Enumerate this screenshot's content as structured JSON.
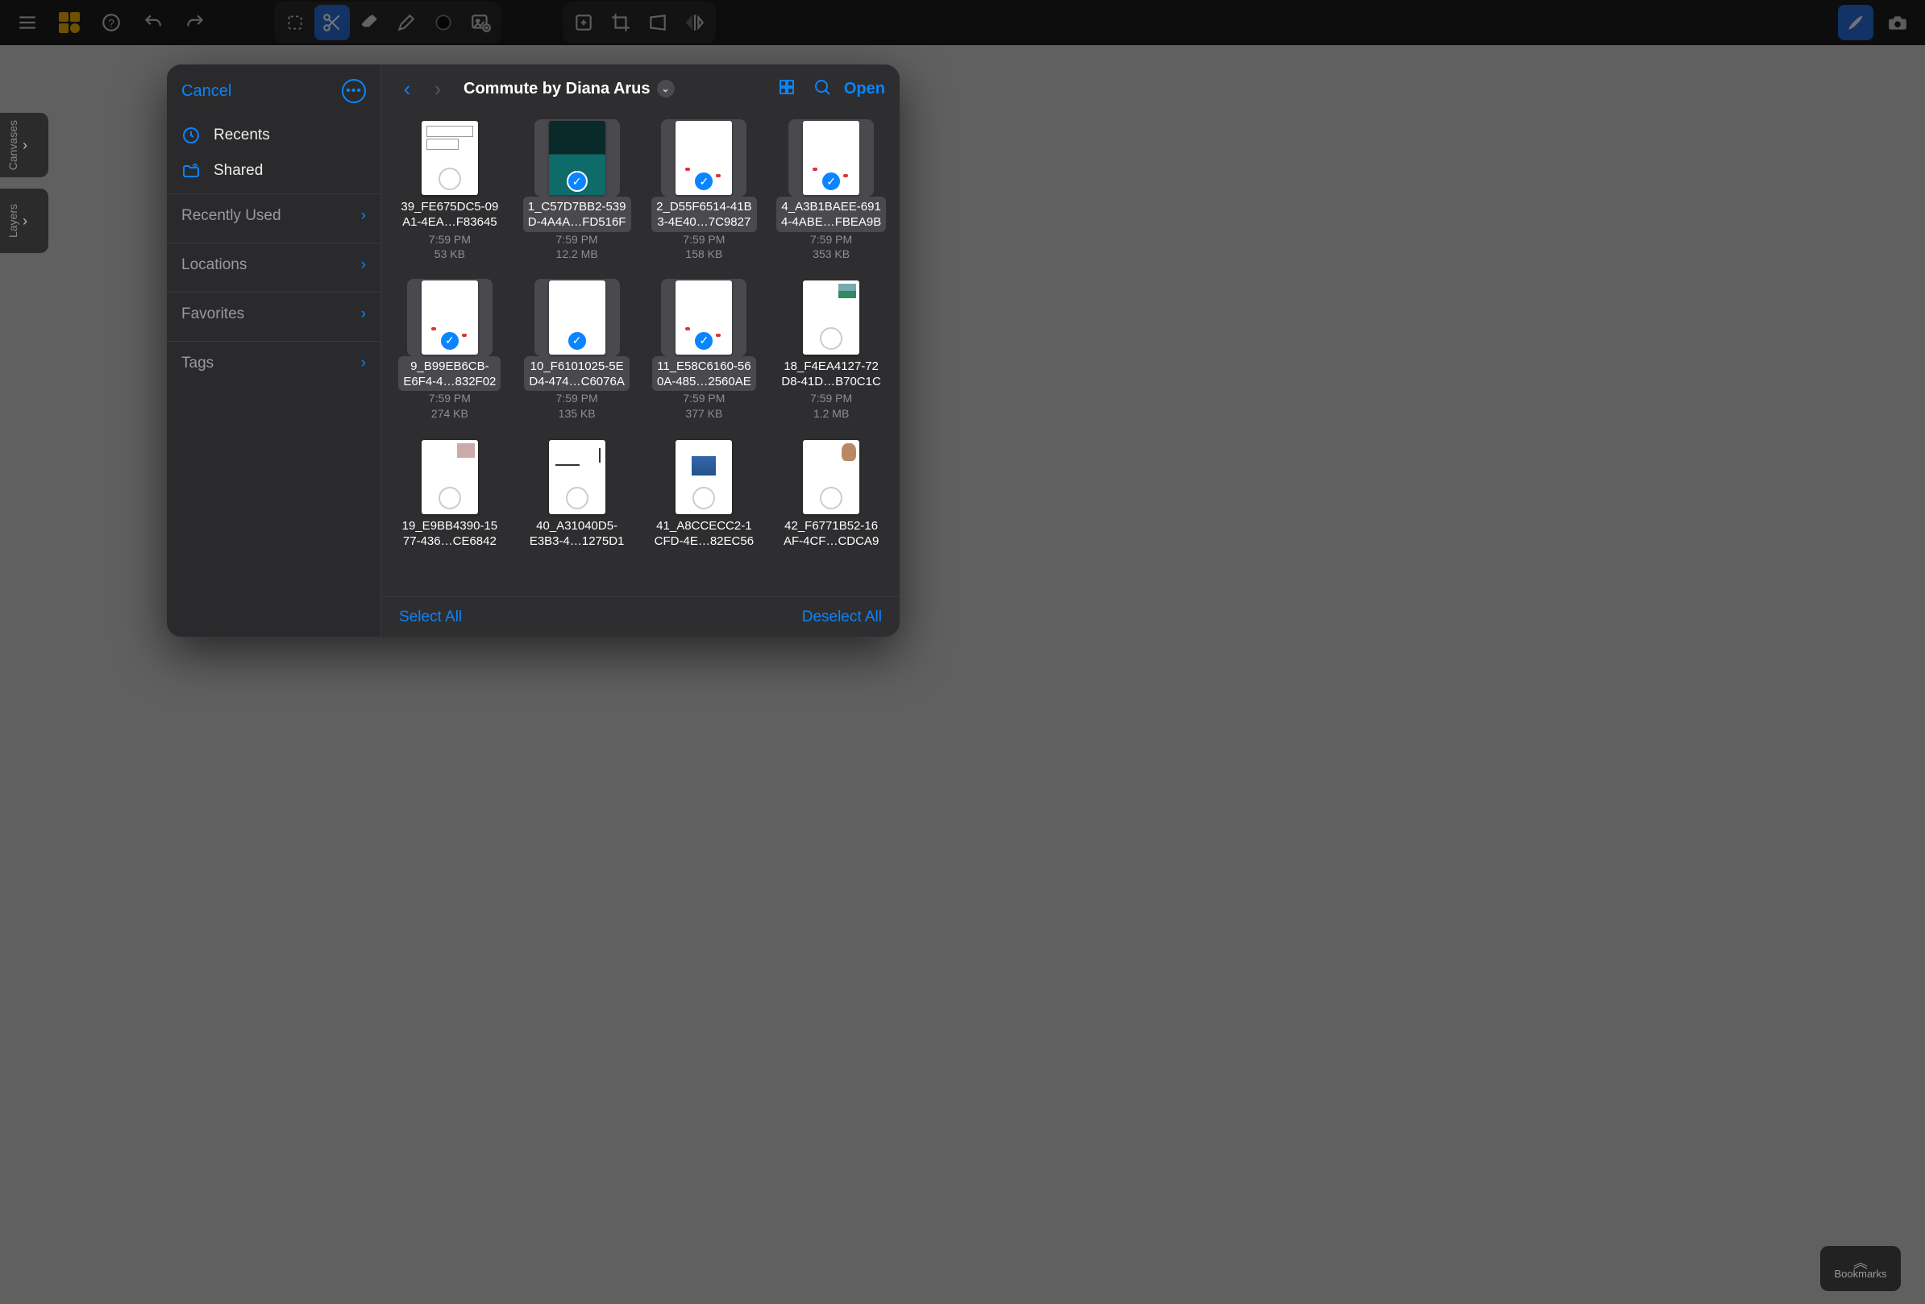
{
  "toolbar": {},
  "side_tabs": {
    "canvases": "Canvases",
    "layers": "Layers"
  },
  "bookmarks_label": "Bookmarks",
  "picker": {
    "cancel": "Cancel",
    "sidebar": {
      "recents": "Recents",
      "shared": "Shared",
      "sections": [
        "Recently Used",
        "Locations",
        "Favorites",
        "Tags"
      ]
    },
    "header": {
      "title": "Commute by Diana Arus",
      "open": "Open"
    },
    "footer": {
      "select_all": "Select All",
      "deselect_all": "Deselect All"
    },
    "files": [
      {
        "name_l1": "39_FE675DC5-09",
        "name_l2": "A1-4EA…F83645",
        "time": "7:59 PM",
        "size": "53 KB",
        "selected": false,
        "thumb": "layout"
      },
      {
        "name_l1": "1_C57D7BB2-539",
        "name_l2": "D-4A4A…FD516F",
        "time": "7:59 PM",
        "size": "12.2 MB",
        "selected": true,
        "thumb": "photo"
      },
      {
        "name_l1": "2_D55F6514-41B",
        "name_l2": "3-4E40…7C9827",
        "time": "7:59 PM",
        "size": "158 KB",
        "selected": true,
        "thumb": "dots"
      },
      {
        "name_l1": "4_A3B1BAEE-691",
        "name_l2": "4-4ABE…FBEA9B",
        "time": "7:59 PM",
        "size": "353 KB",
        "selected": true,
        "thumb": "dots"
      },
      {
        "name_l1": "9_B99EB6CB-",
        "name_l2": "E6F4-4…832F02",
        "time": "7:59 PM",
        "size": "274 KB",
        "selected": true,
        "thumb": "dots"
      },
      {
        "name_l1": "10_F6101025-5E",
        "name_l2": "D4-474…C6076A",
        "time": "7:59 PM",
        "size": "135 KB",
        "selected": true,
        "thumb": "plain"
      },
      {
        "name_l1": "11_E58C6160-56",
        "name_l2": "0A-485…2560AE",
        "time": "7:59 PM",
        "size": "377 KB",
        "selected": true,
        "thumb": "dots"
      },
      {
        "name_l1": "18_F4EA4127-72",
        "name_l2": "D8-41D…B70C1C",
        "time": "7:59 PM",
        "size": "1.2 MB",
        "selected": false,
        "thumb": "corner-green"
      },
      {
        "name_l1": "19_E9BB4390-15",
        "name_l2": "77-436…CE6842",
        "time": "",
        "size": "",
        "selected": false,
        "thumb": "corner-people"
      },
      {
        "name_l1": "40_A31040D5-",
        "name_l2": "E3B3-4…1275D1",
        "time": "",
        "size": "",
        "selected": false,
        "thumb": "lines2"
      },
      {
        "name_l1": "41_A8CCECC2-1",
        "name_l2": "CFD-4E…82EC56",
        "time": "",
        "size": "",
        "selected": false,
        "thumb": "corner-blue"
      },
      {
        "name_l1": "42_F6771B52-16",
        "name_l2": "AF-4CF…CDCA9",
        "time": "",
        "size": "",
        "selected": false,
        "thumb": "corner-dog"
      }
    ]
  }
}
